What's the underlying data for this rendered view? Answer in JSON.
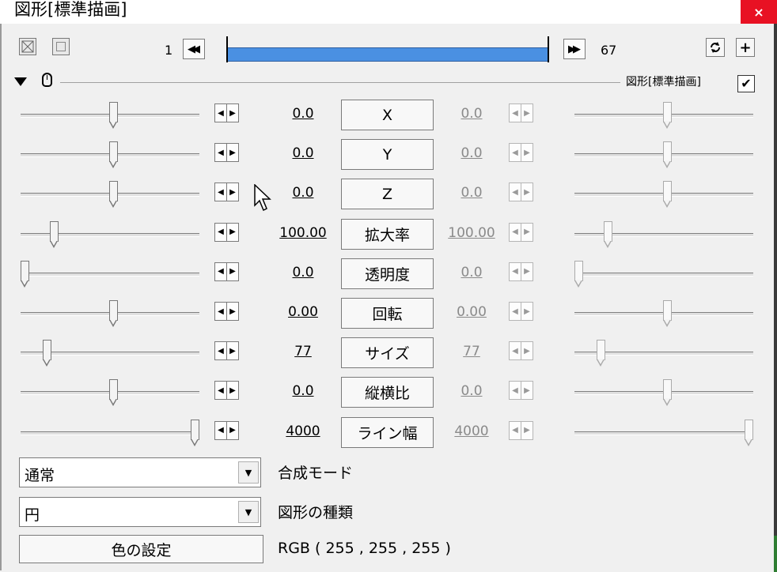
{
  "window": {
    "title": "図形[標準描画]",
    "close_label": "×"
  },
  "toolbar": {
    "frame_start": "1",
    "frame_end": "67",
    "prev_label": "◀◀",
    "next_label": "▶▶",
    "icons": [
      "view-icon",
      "frame-icon",
      "link-icon",
      "add-icon"
    ],
    "add_label": "+"
  },
  "object_header": {
    "label": "図形[標準描画]",
    "enabled": true,
    "check_mark": "✔"
  },
  "params": [
    {
      "name": "X",
      "value_start": "0.0",
      "value_end": "0.0",
      "slider_start": 0.52,
      "slider_end": 0.52
    },
    {
      "name": "Y",
      "value_start": "0.0",
      "value_end": "0.0",
      "slider_start": 0.52,
      "slider_end": 0.52
    },
    {
      "name": "Z",
      "value_start": "0.0",
      "value_end": "0.0",
      "slider_start": 0.52,
      "slider_end": 0.52
    },
    {
      "name": "拡大率",
      "value_start": "100.00",
      "value_end": "100.00",
      "slider_start": 0.17,
      "slider_end": 0.17
    },
    {
      "name": "透明度",
      "value_start": "0.0",
      "value_end": "0.0",
      "slider_start": 0.0,
      "slider_end": 0.0
    },
    {
      "name": "回転",
      "value_start": "0.00",
      "value_end": "0.00",
      "slider_start": 0.52,
      "slider_end": 0.52
    },
    {
      "name": "サイズ",
      "value_start": "77",
      "value_end": "77",
      "slider_start": 0.13,
      "slider_end": 0.13
    },
    {
      "name": "縦横比",
      "value_start": "0.0",
      "value_end": "0.0",
      "slider_start": 0.52,
      "slider_end": 0.52
    },
    {
      "name": "ライン幅",
      "value_start": "4000",
      "value_end": "4000",
      "slider_start": 1.0,
      "slider_end": 1.0
    }
  ],
  "blend_mode": {
    "value": "通常",
    "label": "合成モード"
  },
  "shape_type": {
    "value": "円",
    "label": "図形の種類"
  },
  "color": {
    "button_label": "色の設定",
    "value_text": "RGB ( 255 , 255 , 255 )"
  },
  "colors": {
    "timeline_bar": "#4a90e2",
    "close_button": "#e81123",
    "background": "#f0f0f0"
  }
}
